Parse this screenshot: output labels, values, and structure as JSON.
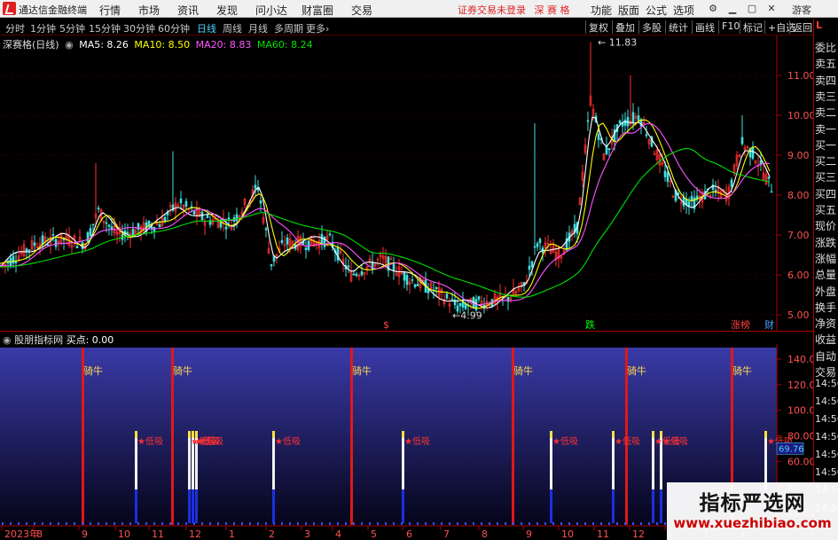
{
  "app": {
    "title": "通达信金融终端"
  },
  "menu": {
    "items": [
      "行情",
      "市场",
      "资讯",
      "发现",
      "问小达",
      "财富圈",
      "交易"
    ],
    "trade_status": "证券交易未登录",
    "stock_name": "深 赛 格",
    "right_items": [
      "功能",
      "版面",
      "公式",
      "选项"
    ],
    "guest": "游客"
  },
  "periods": {
    "items": [
      "分时",
      "1分钟",
      "5分钟",
      "15分钟",
      "30分钟",
      "60分钟",
      "日线",
      "周线",
      "月线",
      "多周期",
      "更多"
    ],
    "active": "日线"
  },
  "toolbar_right": [
    "复权",
    "叠加",
    "多股",
    "统计",
    "画线",
    "F10",
    "标记",
    "+自选",
    "返回"
  ],
  "sidebar": {
    "label": "L",
    "items": [
      "委比",
      "卖五",
      "卖四",
      "卖三",
      "卖二",
      "卖一",
      "买一",
      "买二",
      "买三",
      "买四",
      "买五",
      "现价",
      "涨跌",
      "涨幅",
      "总量",
      "外盘",
      "换手",
      "净资",
      "收益",
      "自动",
      "交易",
      "14:56",
      "14:56",
      "14:56",
      "14:56",
      "14:56",
      "14:56",
      "14:56",
      "14:56"
    ]
  },
  "main_chart": {
    "stock_title": "深赛格(日线)",
    "ma": [
      {
        "label": "MA5: 8.26",
        "color": "#ffffff"
      },
      {
        "label": "MA10: 8.50",
        "color": "#ffff00"
      },
      {
        "label": "MA20: 8.83",
        "color": "#ff55ff"
      },
      {
        "label": "MA60: 8.24",
        "color": "#00e000"
      }
    ],
    "y_ticks": [
      "11.00",
      "10.00",
      "9.00",
      "8.00",
      "7.00",
      "6.00",
      "5.00"
    ],
    "annotations": {
      "high": "11.83",
      "low": "4.99"
    },
    "markers": [
      {
        "text": "$",
        "color": "#ff4040"
      },
      {
        "text": "跌",
        "color": "#00ff00"
      },
      {
        "text": "涨榜",
        "color": "#ff4040"
      },
      {
        "text": "财",
        "color": "#4fa0ff"
      }
    ]
  },
  "indicator": {
    "title": "股朋指标网",
    "value_label": "买点: 0.00",
    "y_ticks": [
      "140.00",
      "120.00",
      "100.00",
      "80.00",
      "60.00",
      "40.00",
      "20.00"
    ],
    "current_value": "69.76",
    "signal_top": "骑牛",
    "signal_low": "低吸"
  },
  "x_axis": {
    "labels": [
      "2023年",
      "8",
      "9",
      "10",
      "11",
      "12",
      "1",
      "2",
      "3",
      "4",
      "5",
      "6",
      "7",
      "8",
      "9",
      "10",
      "11",
      "12",
      "1",
      "2",
      "3"
    ]
  },
  "watermark": {
    "title": "指标严选网",
    "url": "www.xuezhibiao.com"
  }
}
